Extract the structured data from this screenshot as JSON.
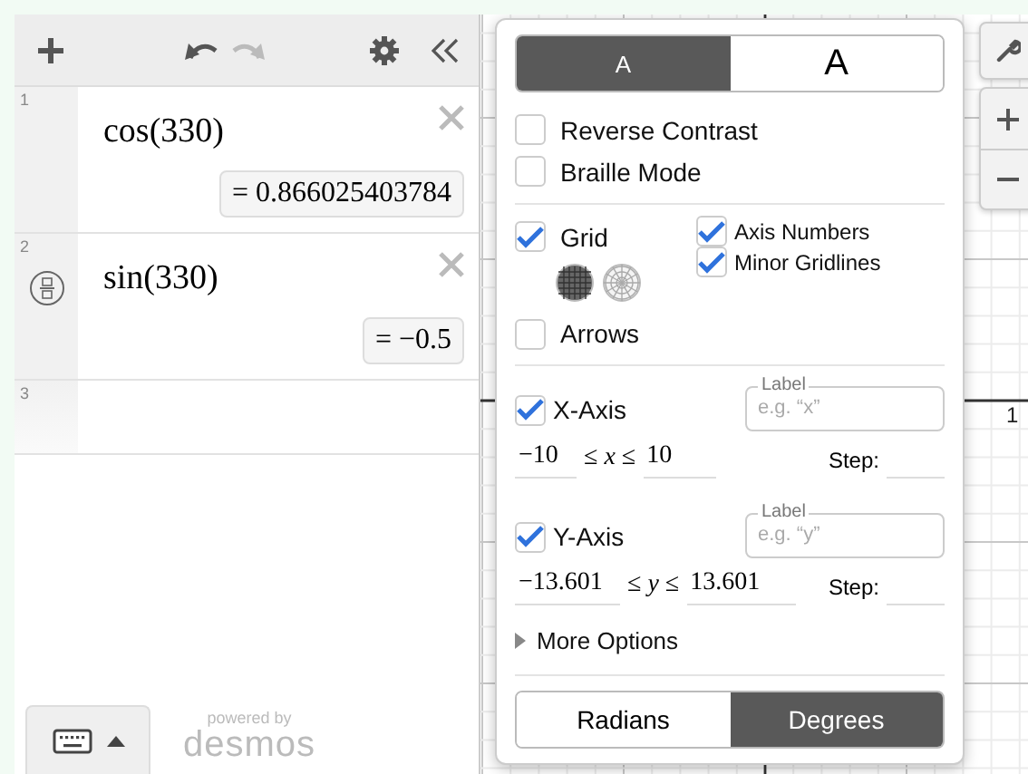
{
  "expressions": [
    {
      "index": "1",
      "expression": "cos(330)",
      "result": "= 0.866025403784",
      "fraction_toggle": false
    },
    {
      "index": "2",
      "expression": "sin(330)",
      "result": "= −0.5",
      "fraction_toggle": true
    },
    {
      "index": "3",
      "fraction_toggle": false
    }
  ],
  "footer": {
    "powered_by": "powered by",
    "brand": "desmos"
  },
  "graph": {
    "axis_label": "1"
  },
  "settings": {
    "text_size": [
      {
        "label": "A",
        "kind": "small",
        "selected": true
      },
      {
        "label": "A",
        "kind": "large",
        "selected": false
      }
    ],
    "options": [
      {
        "label": "Reverse Contrast",
        "checked": false
      },
      {
        "label": "Braille Mode",
        "checked": false
      }
    ],
    "grid": {
      "label": "Grid",
      "checked": true,
      "types": [
        {
          "kind": "cartesian",
          "selected": true
        },
        {
          "kind": "polar",
          "selected": false
        }
      ]
    },
    "grid_options": [
      {
        "label": "Axis Numbers",
        "checked": true
      },
      {
        "label": "Minor Gridlines",
        "checked": true
      }
    ],
    "arrows": {
      "label": "Arrows",
      "checked": false
    },
    "axes": [
      {
        "label": "X-Axis",
        "checked": true,
        "field_label": "Label",
        "placeholder": "e.g. “x”",
        "min": "−10",
        "relation": "≤ *x* ≤",
        "max": "10",
        "step_label": "Step:"
      },
      {
        "label": "Y-Axis",
        "checked": true,
        "field_label": "Label",
        "placeholder": "e.g. “y”",
        "min": "−13.601",
        "relation": "≤ *y* ≤",
        "max": "13.601",
        "step_label": "Step:"
      }
    ],
    "more_options": {
      "label": "More Options",
      "expanded": false
    },
    "angle_modes": [
      {
        "label": "Radians",
        "selected": false
      },
      {
        "label": "Degrees",
        "selected": true
      }
    ]
  }
}
